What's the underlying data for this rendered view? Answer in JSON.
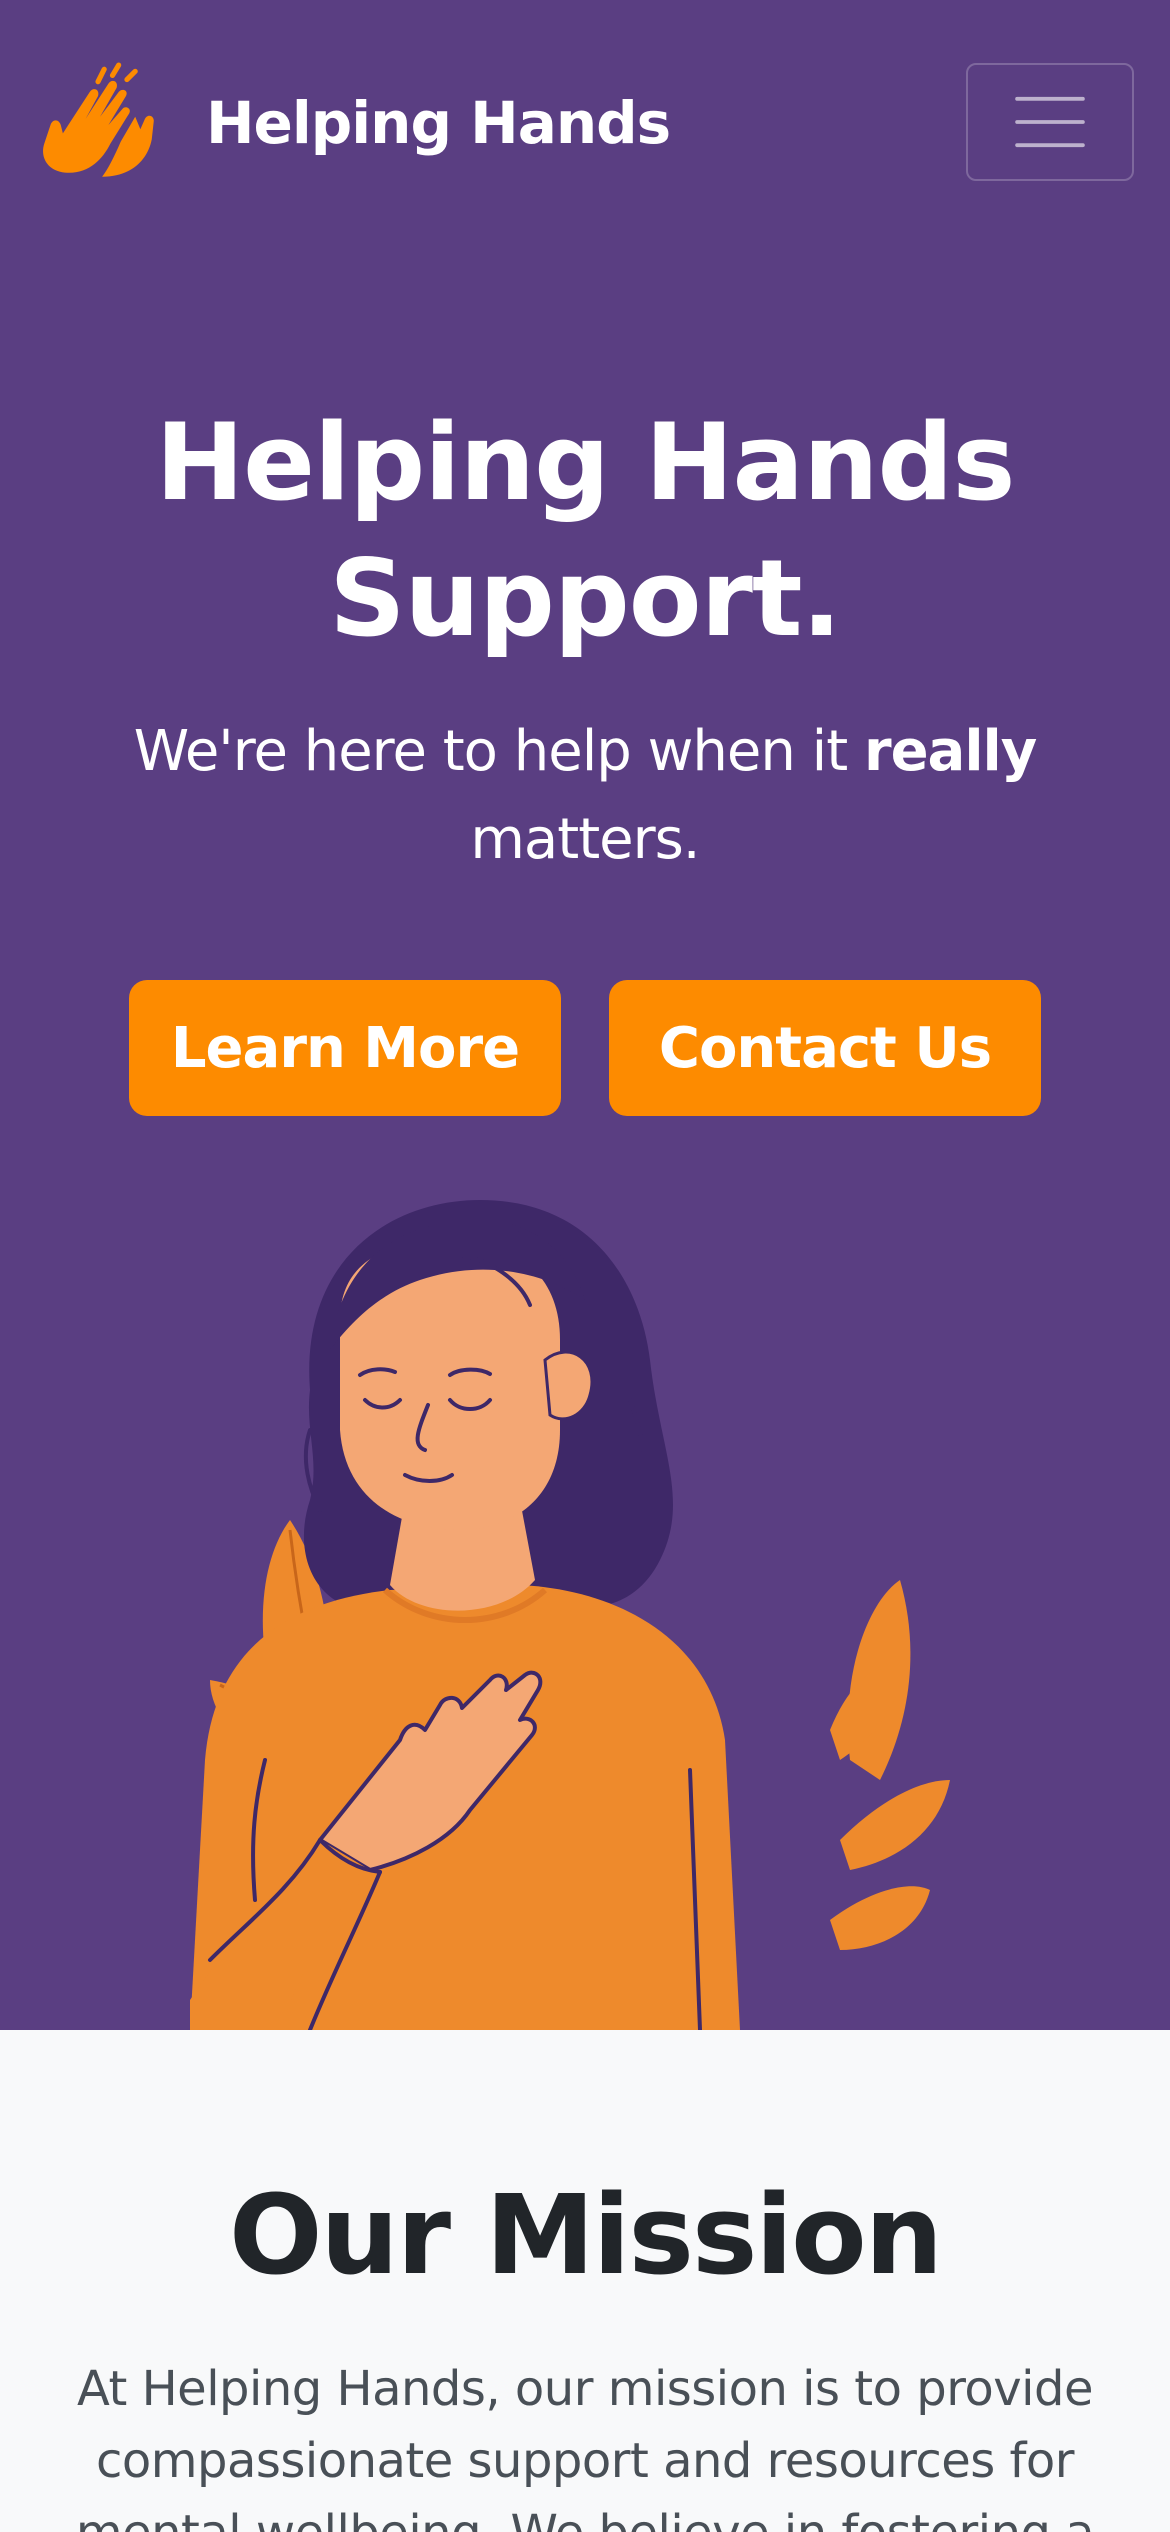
{
  "navbar": {
    "brand_name": "Helping Hands",
    "logo_icon": "raised-hands-icon",
    "menu_icon": "hamburger-menu-icon"
  },
  "hero": {
    "title": "Helping Hands Support.",
    "lead_prefix": "We're here to help when it ",
    "lead_emphasis": "really",
    "lead_suffix": " matters.",
    "primary_button": "Learn More",
    "secondary_button": "Contact Us",
    "illustration": "woman-hand-on-heart-illustration"
  },
  "mission": {
    "title": "Our Mission",
    "text": "At Helping Hands, our mission is to provide compassionate support and resources for mental wellbeing. We believe in fostering a"
  },
  "colors": {
    "primary_purple": "#5a3e82",
    "accent_orange": "#fd8b00",
    "light_background": "#f8f9fa",
    "dark_text": "#212529",
    "body_text": "#495057"
  }
}
